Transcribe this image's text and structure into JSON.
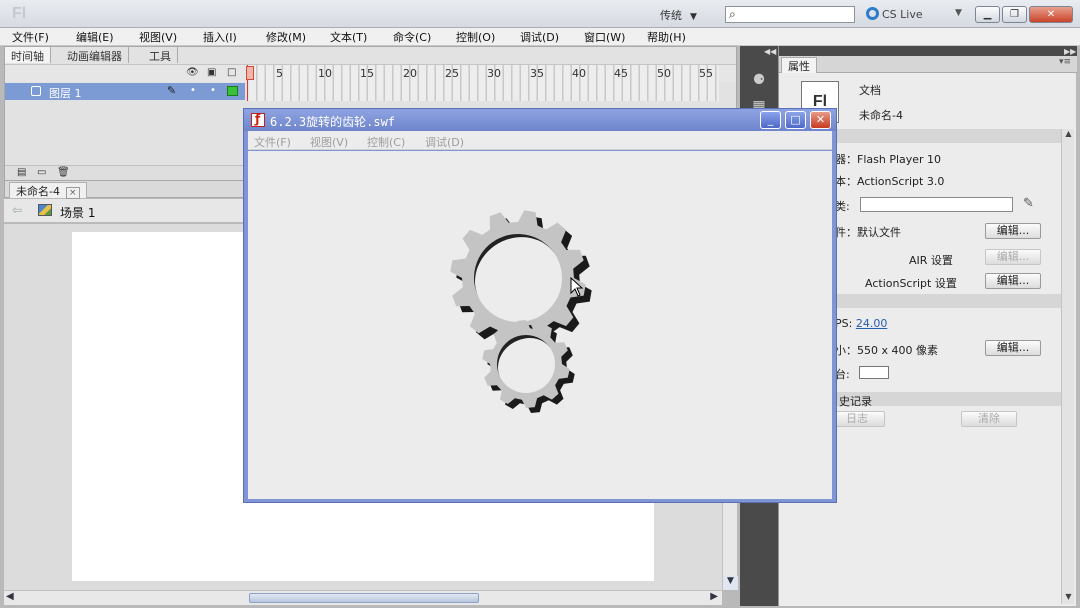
{
  "app": {
    "logo": "Fl",
    "workspace": "传统",
    "cslive": "CS Live",
    "window_buttons": [
      "minimize",
      "restore",
      "close"
    ]
  },
  "menubar": [
    "文件(F)",
    "编辑(E)",
    "视图(V)",
    "插入(I)",
    "修改(M)",
    "文本(T)",
    "命令(C)",
    "控制(O)",
    "调试(D)",
    "窗口(W)",
    "帮助(H)"
  ],
  "timeline": {
    "tabs": [
      "时间轴",
      "动画编辑器",
      "工具"
    ],
    "frame_numbers": [
      "5",
      "10",
      "15",
      "20",
      "25",
      "30",
      "35",
      "40",
      "45",
      "50",
      "55"
    ],
    "layer_name": "图层 1",
    "header_icons": [
      "eye-icon",
      "lock-icon",
      "outline-icon"
    ],
    "footer_icons": [
      "new-layer-icon",
      "new-folder-icon",
      "delete-icon"
    ]
  },
  "document": {
    "tab_name": "未命名-4",
    "tab_close": "×",
    "scene_name": "场景 1"
  },
  "properties": {
    "tab": "属性",
    "doc_icon": "Fl",
    "doc_type": "文档",
    "doc_name": "未命名-4",
    "player_label": "器：Flash Player 10",
    "script_label": "本：ActionScript 3.0",
    "class_label": "类:",
    "profile_label": "件：默认文件",
    "air_label": "AIR 设置",
    "as_label": "ActionScript 设置",
    "fps_label": "PS:",
    "fps_value": "24.00",
    "size_label": "小：550 x 400 像素",
    "stage_label": "台:",
    "history_label": "史记录",
    "edit_button": "编辑...",
    "log_button": "日志",
    "clear_button": "清除"
  },
  "swf_window": {
    "title": "6.2.3旋转的齿轮.swf",
    "menu": [
      "文件(F)",
      "视图(V)",
      "控制(C)",
      "调试(D)"
    ],
    "buttons": [
      "_",
      "□",
      "✕"
    ]
  },
  "colors": {
    "layer_highlight": "#7c9ad4",
    "swf_title_bar": "#7f95d6",
    "gear_fill": "#c4c4c4",
    "gear_shadow": "#1a1a1a"
  }
}
